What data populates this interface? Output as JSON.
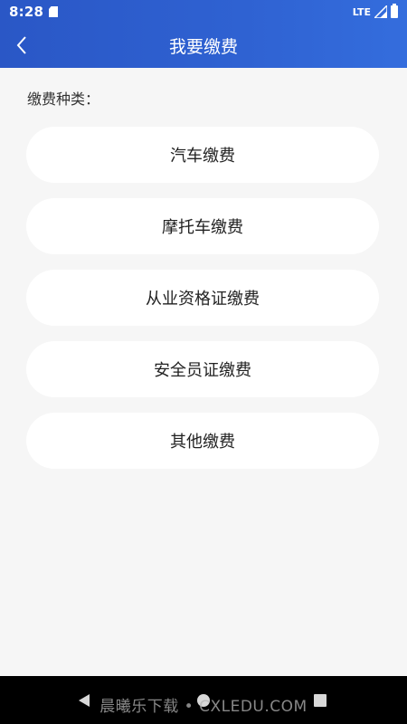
{
  "status_bar": {
    "time": "8:28",
    "network": "LTE"
  },
  "header": {
    "title": "我要缴费",
    "bg_color": "#2f62d2"
  },
  "section": {
    "label": "缴费种类："
  },
  "payment_types": [
    {
      "label": "汽车缴费"
    },
    {
      "label": "摩托车缴费"
    },
    {
      "label": "从业资格证缴费"
    },
    {
      "label": "安全员证缴费"
    },
    {
      "label": "其他缴费"
    }
  ],
  "watermark": {
    "text": "晨曦乐下载 • CXLEDU.COM"
  }
}
